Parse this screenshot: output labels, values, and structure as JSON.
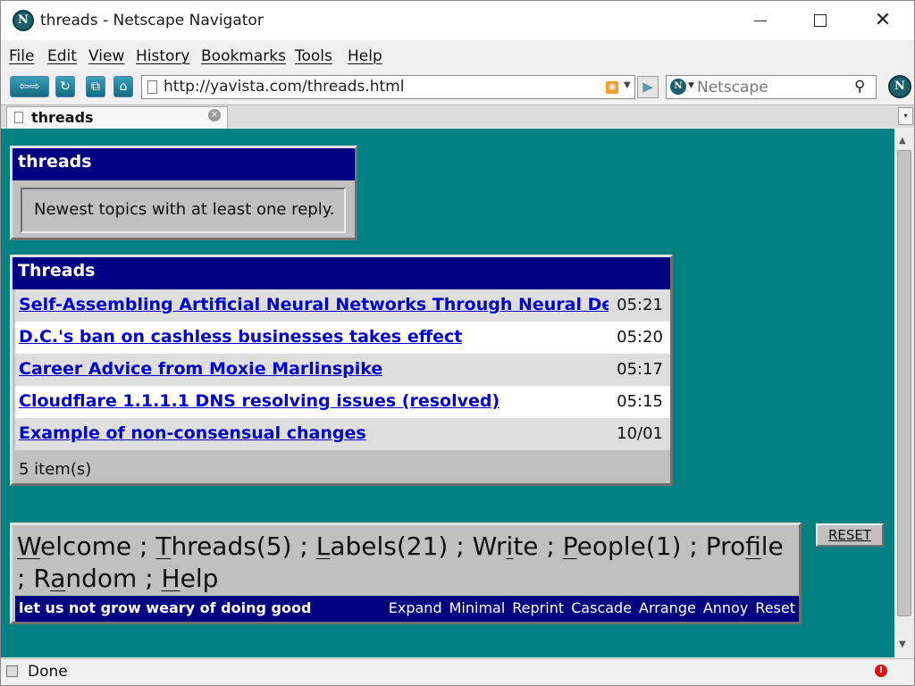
{
  "window": {
    "title": "threads - Netscape Navigator",
    "logo_glyph": "N",
    "minimize_icon": "minimize-icon",
    "maximize_icon": "maximize-icon",
    "close_glyph": "✕"
  },
  "menu": {
    "items": [
      "File",
      "Edit",
      "View",
      "History",
      "Bookmarks",
      "Tools",
      "Help"
    ]
  },
  "toolbar": {
    "back_forward_glyph": "⇦⇨",
    "reload_glyph": "↻",
    "new_tab_glyph": "⧉",
    "home_glyph": "⌂",
    "url": "http://yavista.com/threads.html",
    "rss_glyph": "◉",
    "go_glyph": "▶",
    "search_engine_glyph": "N",
    "search_placeholder": "Netscape",
    "search_glyph": "⚲",
    "throbber_glyph": "N"
  },
  "tabs": {
    "active": {
      "label": "threads",
      "close_glyph": "×"
    },
    "list_glyph": "▾"
  },
  "intro_box": {
    "heading": "threads",
    "text": "Newest topics with at least one reply."
  },
  "threads_box": {
    "heading": "Threads",
    "rows": [
      {
        "title": "Self-Assembling Artificial Neural Networks Through Neural Devel",
        "time": "05:21"
      },
      {
        "title": "D.C.'s ban on cashless businesses takes effect",
        "time": "05:20"
      },
      {
        "title": "Career Advice from Moxie Marlinspike",
        "time": "05:17"
      },
      {
        "title": "Cloudflare 1.1.1.1 DNS resolving issues (resolved)",
        "time": "05:15"
      },
      {
        "title": "Example of non-consensual changes",
        "time": "10/01"
      }
    ],
    "count": "5 item(s)"
  },
  "footer": {
    "nav": [
      {
        "before": "",
        "key": "W",
        "after": "elcome"
      },
      {
        "before": "",
        "key": "T",
        "after": "hreads(5)"
      },
      {
        "before": "",
        "key": "L",
        "after": "abels(21)"
      },
      {
        "before": "Wr",
        "key": "i",
        "after": "te"
      },
      {
        "before": "",
        "key": "P",
        "after": "eople(1)"
      },
      {
        "before": "Pro",
        "key": "f",
        "after": "ile"
      },
      {
        "before": "R",
        "key": "a",
        "after": "ndom"
      },
      {
        "before": "",
        "key": "H",
        "after": "elp"
      }
    ],
    "separator": " ; ",
    "motto": "let us not grow weary of doing good",
    "actions": [
      "Expand",
      "Minimal",
      "Reprint",
      "Cascade",
      "Arrange",
      "Annoy",
      "Reset"
    ]
  },
  "reset_button": "RESET",
  "status": {
    "text": "Done",
    "alert_glyph": "!"
  },
  "colors": {
    "page_background": "#008080",
    "box_header": "#000080",
    "link": "#0000cc",
    "panel": "#c0c0c0"
  }
}
